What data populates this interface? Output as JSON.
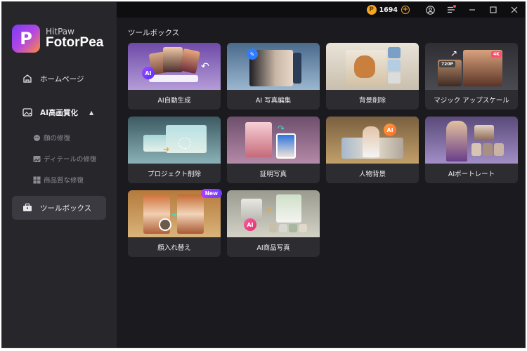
{
  "app": {
    "brand_sub": "HitPaw",
    "brand_main": "FotorPea",
    "logo_letter": "P"
  },
  "titlebar": {
    "coins": "1694",
    "coin_letter": "P",
    "add_coin_label": "+"
  },
  "sidebar": {
    "home": "ホームページ",
    "ai_quality": "AI高画質化",
    "subitems": [
      "顔の修復",
      "ディテールの修復",
      "商品質な修復"
    ],
    "toolbox": "ツールボックス"
  },
  "main": {
    "section_title": "ツールボックス",
    "cards": [
      {
        "label": "AI自動生成",
        "badge": "AI"
      },
      {
        "label": "AI 写真編集"
      },
      {
        "label": "背景削除"
      },
      {
        "label": "マジック アップスケール",
        "res_low": "720P",
        "res_high": "4K"
      },
      {
        "label": "プロジェクト削除"
      },
      {
        "label": "証明写真"
      },
      {
        "label": "人物背景",
        "badge": "AI"
      },
      {
        "label": "AIポートレート"
      },
      {
        "label": "顔入れ替え",
        "new": "New"
      },
      {
        "label": "AI商品写真",
        "badge": "AI"
      }
    ]
  },
  "colors": {
    "accent": "#7b3df0",
    "coin": "#f5a623",
    "sidebar_bg": "#26262b",
    "main_bg": "#1b1b1f"
  }
}
